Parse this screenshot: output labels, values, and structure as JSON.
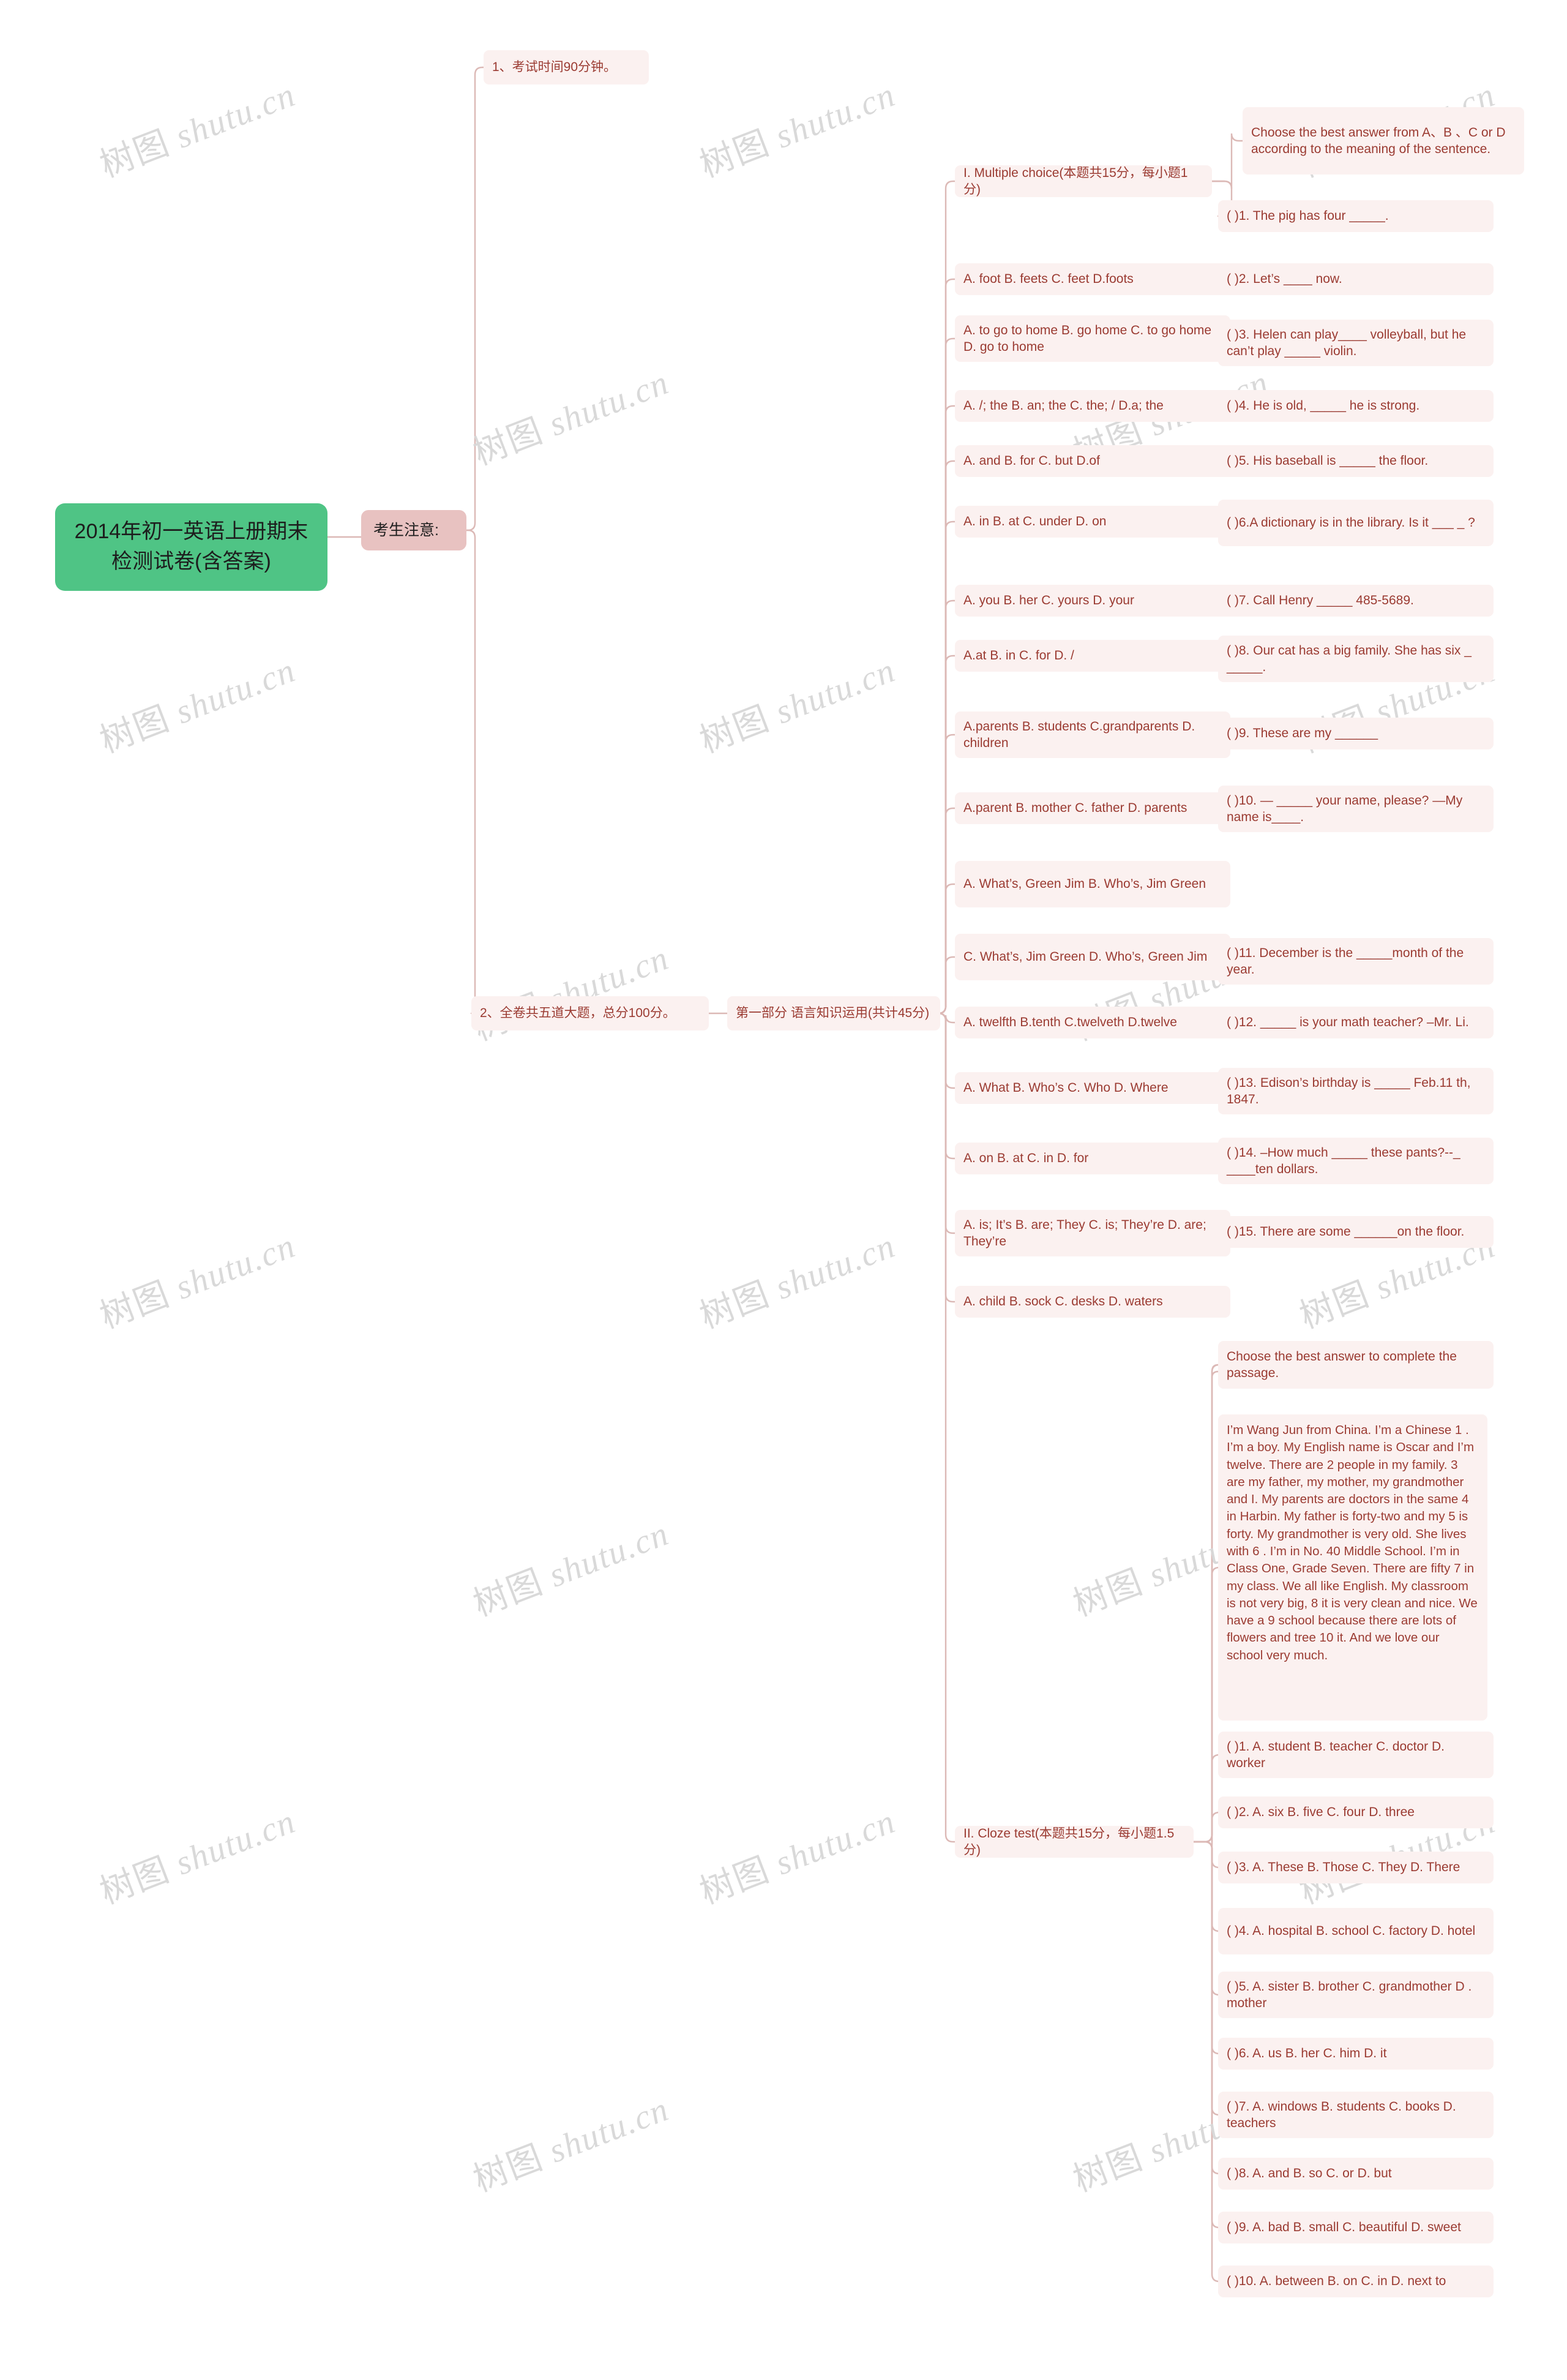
{
  "meta": {
    "watermark_text": "树图 shutu.cn",
    "colors": {
      "root_bg": "#4fc485",
      "level1_bg": "#e8c2c1",
      "leaf_bg": "#fbf1f0",
      "leaf_text": "#9b3b32",
      "link": "#dcb9b6",
      "canvas": "#ffffff"
    }
  },
  "root": {
    "label": "2014年初一英语上册期末检测试卷(含答案)"
  },
  "level1": {
    "label": "考生注意:"
  },
  "notes": [
    {
      "label": "1、考试时间90分钟。"
    },
    {
      "label": "2、全卷共五道大题，总分100分。"
    }
  ],
  "part1": {
    "label": "第一部分 语言知识运用(共计45分)"
  },
  "sections": {
    "multiple_choice": {
      "label": "I. Multiple choice(本题共15分，每小题1分)"
    },
    "cloze_test": {
      "label": "II. Cloze test(本题共15分，每小题1.5分)"
    }
  },
  "mc_instruction": {
    "label": "Choose the best answer from A、B 、C or D according to the meaning of the sentence."
  },
  "mc_items": [
    {
      "options": "",
      "question": "( )1. The pig has four _____."
    },
    {
      "options": "A. foot B. feets C. feet D.foots",
      "question": "( )2. Let’s ____ now."
    },
    {
      "options": "A. to go to home B. go home C. to go home D. go to home",
      "question": "( )3. Helen can play____ volleyball, but he can’t play _____ violin."
    },
    {
      "options": "A. /; the B. an; the C. the; / D.a; the",
      "question": "( )4. He is old, _____ he is strong."
    },
    {
      "options": "A. and B. for C. but D.of",
      "question": "( )5. His baseball is _____ the floor."
    },
    {
      "options": "A. in B. at C. under D. on",
      "question": "( )6.A dictionary is in the library. Is it ___ _ ?"
    },
    {
      "options": "A. you B. her C. yours D. your",
      "question": "( )7. Call Henry _____ 485-5689."
    },
    {
      "options": "A.at B. in C. for D. /",
      "question": "( )8. Our cat has a big family. She has six _ _____."
    },
    {
      "options": "A.parents B. students C.grandparents D. children",
      "question": "( )9. These are my ______"
    },
    {
      "options": "A.parent B. mother C. father D. parents",
      "question": "( )10. — _____ your name, please? —My name is____."
    },
    {
      "options": "A. What’s, Green Jim B. Who’s, Jim Green",
      "question": ""
    },
    {
      "options": "C. What’s, Jim Green D. Who’s, Green Jim",
      "question": "( )11. December is the _____month of the year."
    },
    {
      "options": "A. twelfth B.tenth C.twelveth D.twelve",
      "question": "( )12. _____ is your math teacher? –Mr. Li."
    },
    {
      "options": "A. What B. Who’s C. Who D. Where",
      "question": "( )13. Edison’s birthday is _____ Feb.11 th, 1847."
    },
    {
      "options": "A. on B. at C. in D. for",
      "question": "( )14. –How much _____ these pants?--_ ____ten dollars."
    },
    {
      "options": "A. is; It’s B. are; They C. is; They’re D. are; They’re",
      "question": "( )15. There are some ______on the floor."
    },
    {
      "options": "A. child B. sock C. desks D. waters",
      "question": ""
    }
  ],
  "cloze_instruction": {
    "label": "Choose the best answer to complete the passage."
  },
  "cloze_passage": {
    "label": "I’m Wang Jun from China. I’m a Chinese 1 . I’m a boy. My English name is Oscar and I’m twelve. There are 2 people in my family. 3 are my father, my mother, my grandmother and I. My parents are doctors in the same 4 in Harbin. My father is forty-two and my 5 is forty. My grandmother is very old. She lives with 6 . I’m in No. 40 Middle School. I’m in Class One, Grade Seven. There are fifty 7 in my class. We all like English. My classroom is not very big, 8 it is very clean and nice. We have a 9 school because there are lots of flowers and tree 10 it. And we love our school very much."
  },
  "cloze_items": [
    {
      "label": "( )1. A. student B. teacher C. doctor D. worker"
    },
    {
      "label": "( )2. A. six B. five C. four D. three"
    },
    {
      "label": "( )3. A. These B. Those C. They D. There"
    },
    {
      "label": "( )4. A. hospital B. school C. factory D. hotel"
    },
    {
      "label": "( )5. A. sister B. brother C. grandmother D . mother"
    },
    {
      "label": "( )6. A. us B. her C. him D. it"
    },
    {
      "label": "( )7. A. windows B. students C. books D. teachers"
    },
    {
      "label": "( )8. A. and B. so C. or D. but"
    },
    {
      "label": "( )9. A. bad B. small C. beautiful D. sweet"
    },
    {
      "label": "( )10. A. between B. on C. in D. next to"
    }
  ]
}
